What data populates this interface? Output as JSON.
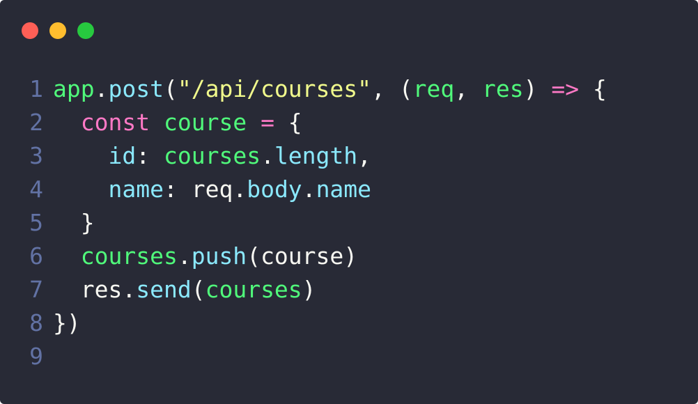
{
  "window": {
    "controls": [
      {
        "name": "close",
        "color": "#ff5f56"
      },
      {
        "name": "minimize",
        "color": "#ffbd2e"
      },
      {
        "name": "maximize",
        "color": "#27c93f"
      }
    ]
  },
  "colors": {
    "background": "#282a36",
    "line_number": "#6272a4",
    "plain": "#f8f8f2",
    "green": "#50fa7b",
    "cyan": "#8be9fd",
    "yellow": "#f1fa8c",
    "pink": "#ff79c6",
    "gray": "#9aa5b1"
  },
  "code": {
    "language": "javascript",
    "lines": [
      {
        "number": "1",
        "tokens": [
          {
            "text": "app",
            "color": "green"
          },
          {
            "text": ".",
            "color": "plain"
          },
          {
            "text": "post",
            "color": "cyan"
          },
          {
            "text": "(",
            "color": "plain"
          },
          {
            "text": "\"/api/courses\"",
            "color": "yellow"
          },
          {
            "text": ", (",
            "color": "plain"
          },
          {
            "text": "req",
            "color": "green"
          },
          {
            "text": ", ",
            "color": "plain"
          },
          {
            "text": "res",
            "color": "green"
          },
          {
            "text": ") ",
            "color": "plain"
          },
          {
            "text": "=>",
            "color": "pink"
          },
          {
            "text": " {",
            "color": "plain"
          }
        ]
      },
      {
        "number": "2",
        "tokens": [
          {
            "text": "  ",
            "color": "plain"
          },
          {
            "text": "const",
            "color": "pink"
          },
          {
            "text": " ",
            "color": "plain"
          },
          {
            "text": "course",
            "color": "green"
          },
          {
            "text": " ",
            "color": "plain"
          },
          {
            "text": "=",
            "color": "pink"
          },
          {
            "text": " {",
            "color": "plain"
          }
        ]
      },
      {
        "number": "3",
        "tokens": [
          {
            "text": "    ",
            "color": "plain"
          },
          {
            "text": "id",
            "color": "cyan"
          },
          {
            "text": ": ",
            "color": "plain"
          },
          {
            "text": "courses",
            "color": "green"
          },
          {
            "text": ".",
            "color": "plain"
          },
          {
            "text": "length",
            "color": "cyan"
          },
          {
            "text": ",",
            "color": "plain"
          }
        ]
      },
      {
        "number": "4",
        "tokens": [
          {
            "text": "    ",
            "color": "plain"
          },
          {
            "text": "name",
            "color": "cyan"
          },
          {
            "text": ": ",
            "color": "plain"
          },
          {
            "text": "req",
            "color": "plain"
          },
          {
            "text": ".",
            "color": "plain"
          },
          {
            "text": "body",
            "color": "cyan"
          },
          {
            "text": ".",
            "color": "plain"
          },
          {
            "text": "name",
            "color": "cyan"
          }
        ]
      },
      {
        "number": "5",
        "tokens": [
          {
            "text": "  }",
            "color": "plain"
          }
        ]
      },
      {
        "number": "6",
        "tokens": [
          {
            "text": "  ",
            "color": "plain"
          },
          {
            "text": "courses",
            "color": "green"
          },
          {
            "text": ".",
            "color": "plain"
          },
          {
            "text": "push",
            "color": "cyan"
          },
          {
            "text": "(",
            "color": "plain"
          },
          {
            "text": "course",
            "color": "plain"
          },
          {
            "text": ")",
            "color": "plain"
          }
        ]
      },
      {
        "number": "7",
        "tokens": [
          {
            "text": "  ",
            "color": "plain"
          },
          {
            "text": "res",
            "color": "plain"
          },
          {
            "text": ".",
            "color": "plain"
          },
          {
            "text": "send",
            "color": "cyan"
          },
          {
            "text": "(",
            "color": "plain"
          },
          {
            "text": "courses",
            "color": "green"
          },
          {
            "text": ")",
            "color": "plain"
          }
        ]
      },
      {
        "number": "8",
        "tokens": [
          {
            "text": "})",
            "color": "plain"
          }
        ]
      },
      {
        "number": "9",
        "tokens": []
      }
    ]
  }
}
